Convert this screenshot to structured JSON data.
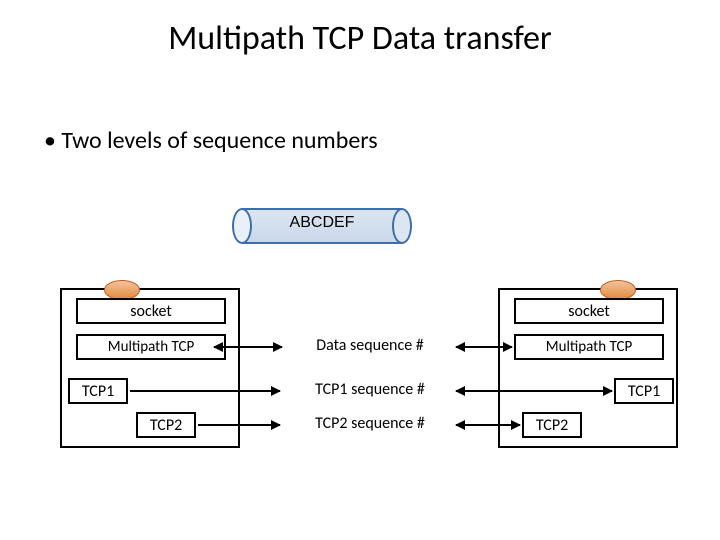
{
  "title": "Multipath TCP Data transfer",
  "bullet": "Two levels of sequence numbers",
  "cylinder_label": "ABCDEF",
  "left_stack": {
    "socket": "socket",
    "mptcp": "Multipath TCP",
    "tcp1": "TCP1",
    "tcp2": "TCP2"
  },
  "right_stack": {
    "socket": "socket",
    "mptcp": "Multipath TCP",
    "tcp1": "TCP1",
    "tcp2": "TCP2"
  },
  "sequence_labels": {
    "data": "Data sequence #",
    "tcp1": "TCP1 sequence #",
    "tcp2": "TCP2 sequence #"
  }
}
